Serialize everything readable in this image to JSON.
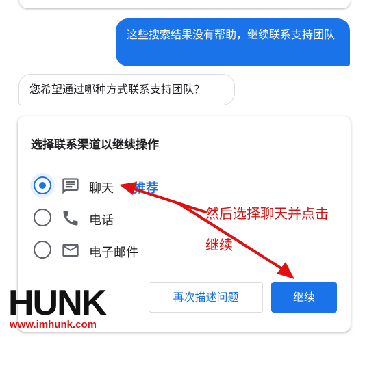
{
  "chat": {
    "user_message": "这些搜索结果没有帮助，继续联系支持团队",
    "agent_message": "您希望通过哪种方式联系支持团队？"
  },
  "channel_card": {
    "title": "选择联系渠道以继续操作",
    "options": [
      {
        "label": "聊天",
        "badge": "推荐",
        "icon": "chat-icon",
        "selected": true
      },
      {
        "label": "电话",
        "icon": "phone-icon",
        "selected": false
      },
      {
        "label": "电子邮件",
        "icon": "email-icon",
        "selected": false
      }
    ],
    "secondary_button": "再次描述问题",
    "primary_button": "继续"
  },
  "annotation": {
    "line1": "然后选择聊天并点击",
    "line2": "继续",
    "color": "#e01010"
  },
  "watermark": {
    "brand": "HUNK",
    "url": "www.imhunk.com"
  },
  "colors": {
    "accent": "#1a73e8",
    "annotation_red": "#e01010"
  }
}
